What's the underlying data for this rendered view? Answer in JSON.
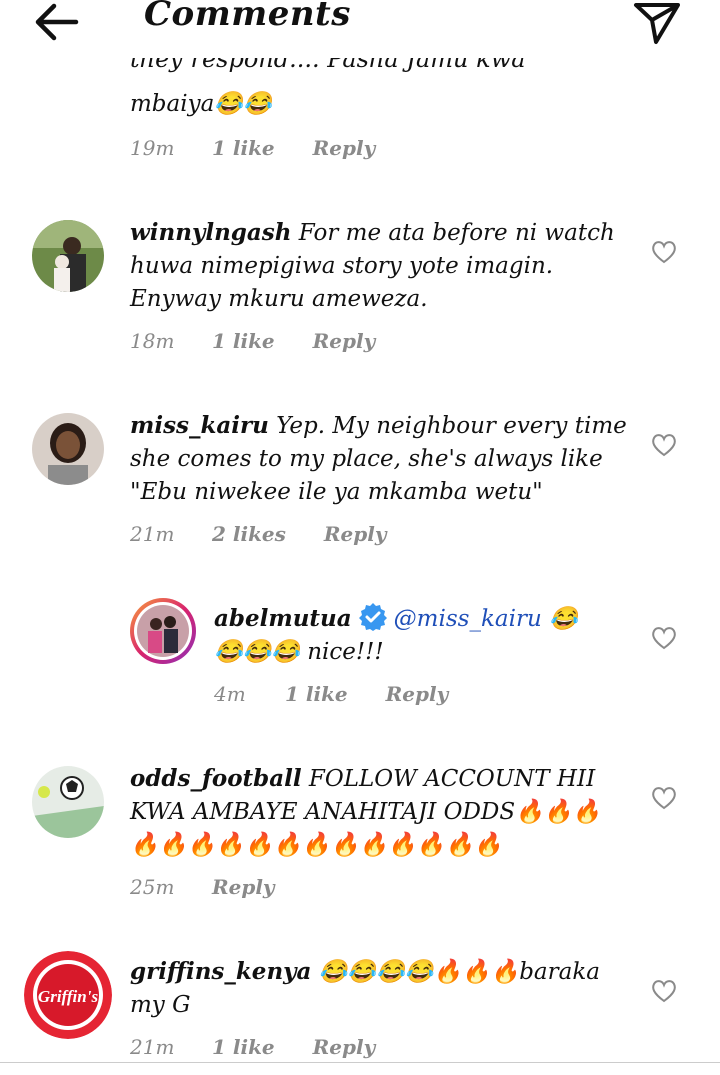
{
  "header": {
    "title": "Comments",
    "back_icon": "back-arrow-icon",
    "send_icon": "paper-plane-icon"
  },
  "clipped_comment": {
    "partial_line": "they respond.... Pasha Jamu kwa kiptin...",
    "text_line2": "mbaiya😂😂",
    "time": "19m",
    "likes": "1 like",
    "reply": "Reply"
  },
  "comments": [
    {
      "username": "winnylngash",
      "text": " For me ata before ni watch huwa nimepigiwa story yote imagin. Enyway mkuru ameweza.",
      "time": "18m",
      "likes": "1 like",
      "reply": "Reply"
    },
    {
      "username": "miss_kairu",
      "text": " Yep. My neighbour every time she comes to my place, she's always like \"Ebu niwekee ile ya mkamba wetu\"",
      "time": "21m",
      "likes": "2 likes",
      "reply": "Reply"
    },
    {
      "username": "abelmutua",
      "mention": "@miss_kairu",
      "text": " 😂😂😂😂 nice!!!",
      "time": "4m",
      "likes": "1 like",
      "reply": "Reply"
    },
    {
      "username": "odds_football",
      "text": " FOLLOW ACCOUNT HII KWA AMBAYE ANAHITAJI ODDS🔥🔥🔥🔥🔥🔥🔥🔥🔥🔥🔥🔥🔥🔥🔥🔥",
      "time": "25m",
      "reply": "Reply"
    },
    {
      "username": "griffins_kenya",
      "text": " 😂😂😂😂🔥🔥🔥baraka my G",
      "time": "21m",
      "likes": "1 like",
      "reply": "Reply"
    }
  ],
  "logo_text": "Griffin's",
  "colors": {
    "verified": "#3897f0",
    "mention": "#1f4fb8",
    "muted": "#8a8a8a",
    "griffins_red": "#d7192a"
  }
}
